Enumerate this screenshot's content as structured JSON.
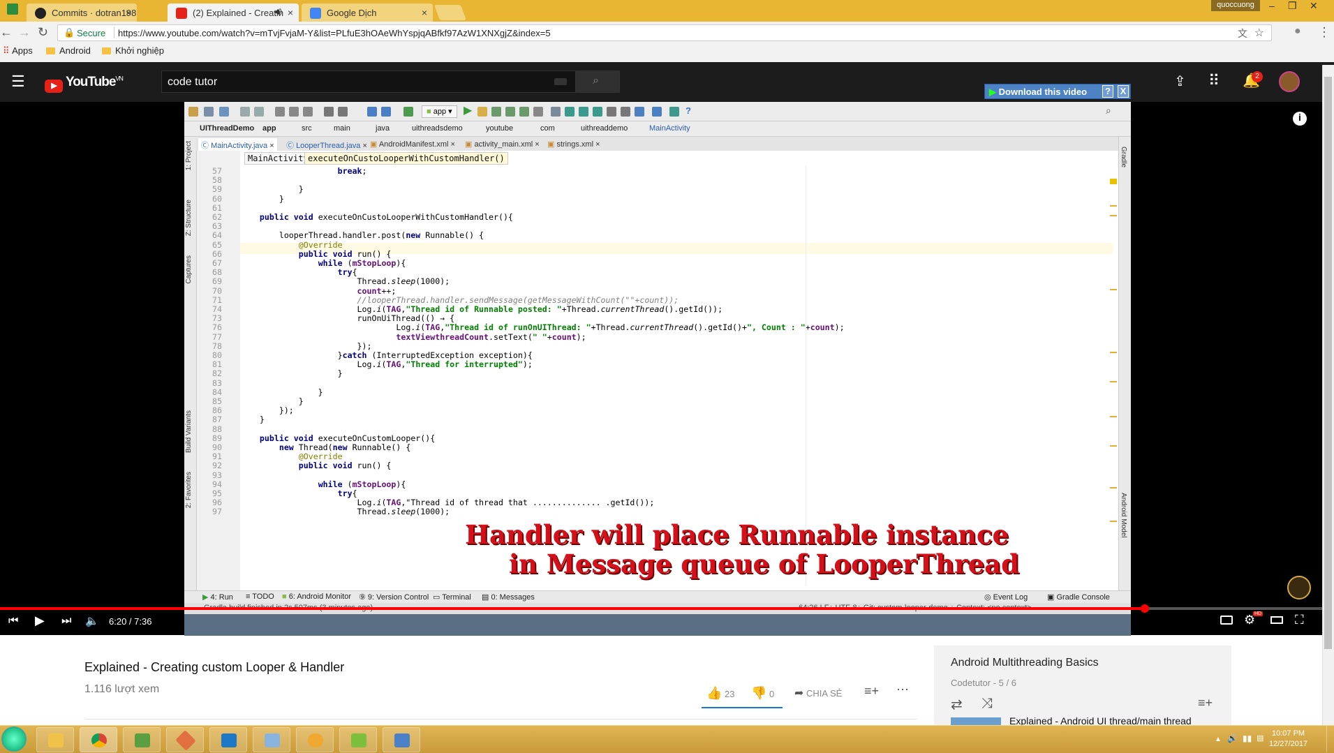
{
  "browser": {
    "tabs": [
      {
        "label": "Commits · dotran1989/ar",
        "close": "×"
      },
      {
        "label": "(2) Explained - Creatin",
        "close": "×",
        "audio": "speaker-icon"
      },
      {
        "label": "Google Dịch",
        "close": "×"
      }
    ],
    "user": "quoccuong",
    "secure_label": "Secure",
    "url": "https://www.youtube.com/watch?v=mTvjFvjaM-Y&list=PLfuE3hOAeWhYspjqABfkf97AzW1XNXgjZ&index=5",
    "bookmarks": [
      "Apps",
      "Android",
      "Khởi nghiệp"
    ]
  },
  "youtube": {
    "logo": "YouTube",
    "region": "VN",
    "search_value": "code tutor",
    "notification_count": "2",
    "download_label": "Download this video",
    "download_help": "?",
    "download_close": "X"
  },
  "ide": {
    "toolbar_app": "app",
    "breadcrumbs": [
      "UIThreadDemo",
      "app",
      "src",
      "main",
      "java",
      "uithreadsdemo",
      "youtube",
      "com",
      "uithreaddemo",
      "MainActivity"
    ],
    "file_tabs": [
      "MainActivity.java",
      "LooperThread.java",
      "AndroidManifest.xml",
      "activity_main.xml",
      "strings.xml"
    ],
    "left_tools": [
      "1: Project",
      "Z: Structure",
      "Captures",
      "Build Variants",
      "2: Favorites"
    ],
    "right_tools": [
      "Gradle",
      "Android Model"
    ],
    "struct_class": "MainActivity",
    "struct_method": "executeOnCustoLooperWithCustomHandler()",
    "bottom_tools": [
      "4: Run",
      "TODO",
      "6: Android Monitor",
      "9: Version Control",
      "Terminal",
      "0: Messages",
      "Event Log",
      "Gradle Console"
    ],
    "status_left": "Gradle build finished in 2s 507ms (3 minutes ago)",
    "status_right": "64:26   LF÷   UTF-8÷   Git: custom-looper-demo ÷   Context: <no context>",
    "line_numbers": [
      "57",
      "58",
      "59",
      "60",
      "61",
      "62",
      "63",
      "64",
      "65",
      "66",
      "67",
      "68",
      "69",
      "70",
      "71",
      "74",
      "73",
      "76",
      "77",
      "78",
      "80",
      "81",
      "82",
      "83",
      "84",
      "85",
      "86",
      "87",
      "88",
      "89",
      "90",
      "91",
      "92",
      "93",
      "94",
      "95",
      "96",
      "97"
    ],
    "code_lines": [
      "                    break;",
      "",
      "            }",
      "        }",
      "",
      "    public void executeOnCustoLooperWithCustomHandler(){",
      "",
      "        looperThread.handler.post(new Runnable() {",
      "            @Override",
      "            public void run() {",
      "                while (mStopLoop){",
      "                    try{",
      "                        Thread.sleep(1000);",
      "                        count++;",
      "                        //looperThread.handler.sendMessage(getMessageWithCount(\"\"+count));",
      "                        Log.i(TAG,\"Thread id of Runnable posted: \"+Thread.currentThread().getId());",
      "                        runOnUiThread(() → {",
      "                                Log.i(TAG,\"Thread id of runOnUIThread: \"+Thread.currentThread().getId()+\", Count : \"+count);",
      "                                textViewthreadCount.setText(\" \"+count);",
      "                        });",
      "                    }catch (InterruptedException exception){",
      "                        Log.i(TAG,\"Thread for interrupted\");",
      "                    }",
      "",
      "                }",
      "            }",
      "        });",
      "    }",
      "",
      "    public void executeOnCustomLooper(){",
      "        new Thread(new Runnable() {",
      "            @Override",
      "            public void run() {",
      "",
      "                while (mStopLoop){",
      "                    try{",
      "                        Log.i(TAG,\"Thread id of thread that .............. .getId());",
      "                        Thread.sleep(1000);"
    ],
    "caption_line1": "Handler will place Runnable instance",
    "caption_line2": "in Message queue of LooperThread"
  },
  "player": {
    "time": "6:20 / 7:36",
    "progress": 0.858
  },
  "video": {
    "title": "Explained - Creating custom Looper & Handler",
    "views": "1.116 lượt xem",
    "likes": "23",
    "dislikes": "0",
    "share": "CHIA SẺ"
  },
  "playlist": {
    "title": "Android Multithreading Basics",
    "subtitle": "Codetutor - 5 / 6",
    "next_item": "Explained - Android UI thread/main thread"
  },
  "taskbar": {
    "time": "10:07 PM",
    "date": "12/27/2017"
  },
  "colors": {
    "accent": "#e62117",
    "taskbar": "#d4a843",
    "chrome_tabstrip": "#e8b632"
  }
}
